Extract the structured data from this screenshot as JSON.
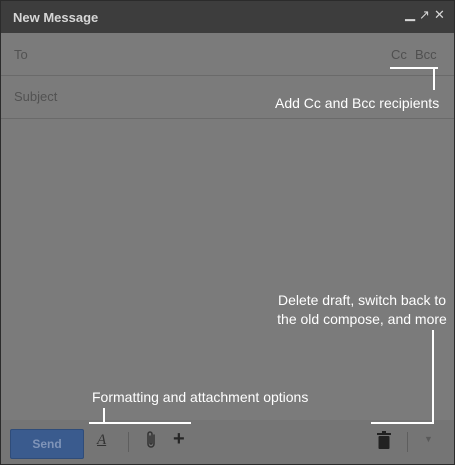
{
  "window": {
    "title": "New Message"
  },
  "header_controls": {
    "minimize": "▁",
    "popout": "↗",
    "close": "✕"
  },
  "fields": {
    "to_label": "To",
    "cc_label": "Cc",
    "bcc_label": "Bcc",
    "subject_placeholder": "Subject"
  },
  "toolbar": {
    "send_label": "Send",
    "format_icon": "A",
    "plus_icon": "+",
    "more_icon": "▼"
  },
  "callouts": {
    "cc_bcc": "Add Cc and Bcc recipients",
    "delete_line1": "Delete draft, switch back to",
    "delete_line2": "the old compose, and more",
    "formatting": "Formatting and attachment options"
  },
  "colors": {
    "overlay": "#7b7b7b",
    "titlebar": "#3d3d3d",
    "send_button": "#3a5b8e",
    "callout_text": "#ffffff"
  }
}
